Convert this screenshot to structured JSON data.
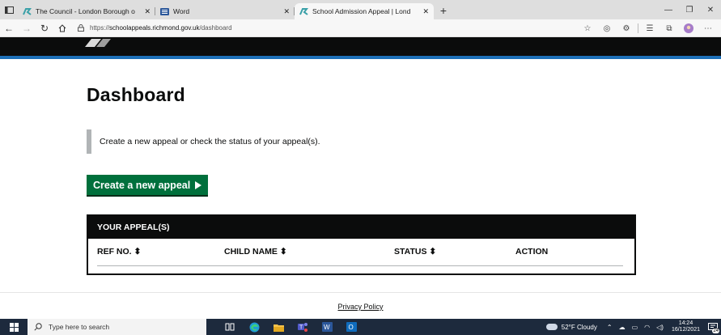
{
  "browser": {
    "tabs": [
      {
        "title": "The Council - London Borough o",
        "icon": "richmond-favicon",
        "active": false
      },
      {
        "title": "Word",
        "icon": "word-favicon",
        "active": false
      },
      {
        "title": "School Admission Appeal | Lond",
        "icon": "richmond-favicon",
        "active": true
      }
    ],
    "address": {
      "prefix": "https://",
      "domain": "schoolappeals.richmond.gov.uk",
      "path": "/dashboard"
    }
  },
  "page": {
    "title": "Dashboard",
    "intro": "Create a new appeal or check the status of your appeal(s).",
    "create_button": "Create a new appeal",
    "appeals": {
      "heading": "YOUR APPEAL(S)",
      "columns": [
        "REF NO. ⬍",
        "CHILD NAME ⬍",
        "STATUS ⬍",
        "ACTION"
      ]
    },
    "footer_link": "Privacy Policy"
  },
  "taskbar": {
    "search_placeholder": "Type here to search",
    "weather": "52°F Cloudy",
    "time": "14:24",
    "date": "16/12/2021",
    "notifications": "24"
  },
  "colors": {
    "header": "#0b0c0c",
    "header_stripe": "#1d70b8",
    "button": "#00703c",
    "inset_border": "#b1b4b6"
  }
}
